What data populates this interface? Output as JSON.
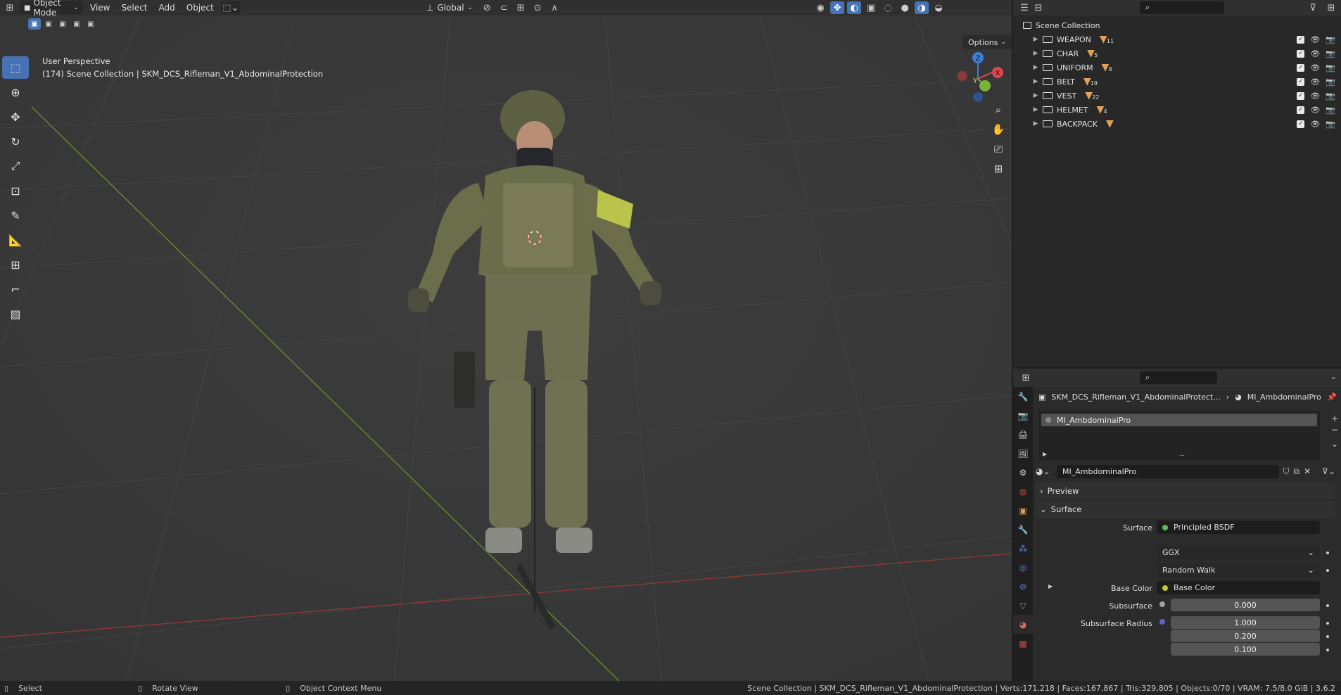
{
  "header": {
    "mode": "Object Mode",
    "menus": [
      "View",
      "Select",
      "Add",
      "Object"
    ],
    "orientation": "Global"
  },
  "viewport": {
    "perspective": "User Perspective",
    "collection_path": "(174) Scene Collection | SKM_DCS_Rifleman_V1_AbdominalProtection",
    "options_label": "Options",
    "gizmo_axes": {
      "x": "X",
      "y": "Y",
      "z": "Z"
    }
  },
  "outliner": {
    "scene_collection": "Scene Collection",
    "items": [
      {
        "name": "WEAPON",
        "count": "11"
      },
      {
        "name": "CHAR",
        "count": "5"
      },
      {
        "name": "UNIFORM",
        "count": "8"
      },
      {
        "name": "BELT",
        "count": "19"
      },
      {
        "name": "VEST",
        "count": "22"
      },
      {
        "name": "HELMET",
        "count": "4"
      },
      {
        "name": "BACKPACK",
        "count": ""
      }
    ]
  },
  "properties": {
    "breadcrumb_object": "SKM_DCS_Rifleman_V1_AbdominalProtect...",
    "breadcrumb_material": "MI_AmbdominalPro",
    "slot_name": "MI_AmbdominalPro",
    "material_name": "MI_AmbdominalPro",
    "preview_label": "Preview",
    "surface_label": "Surface",
    "surface_field_label": "Surface",
    "surface_shader": "Principled BSDF",
    "distribution": "GGX",
    "subsurface_method": "Random Walk",
    "base_color_label": "Base Color",
    "base_color_value": "Base Color",
    "subsurface_label": "Subsurface",
    "subsurface_value": "0.000",
    "subsurface_radius_label": "Subsurface Radius",
    "subsurface_radius": [
      "1.000",
      "0.200",
      "0.100"
    ]
  },
  "statusbar": {
    "left": [
      {
        "label": "Select"
      },
      {
        "label": "Rotate View"
      },
      {
        "label": "Object Context Menu"
      }
    ],
    "right": "Scene Collection | SKM_DCS_Rifleman_V1_AbdominalProtection | Verts:171,218 | Faces:167,867 | Tris:329,805 | Objects:0/70 | VRAM: 7.5/8.0 GiB | 3.6.2"
  },
  "colors": {
    "accent": "#4772b3",
    "x_axis": "#e0454f",
    "y_axis": "#7ab33a",
    "z_axis": "#3d7fd8",
    "socket_shader": "#5bbd5b",
    "socket_color": "#c7c729",
    "socket_float": "#a1a1a1",
    "socket_vector": "#6363c7"
  }
}
